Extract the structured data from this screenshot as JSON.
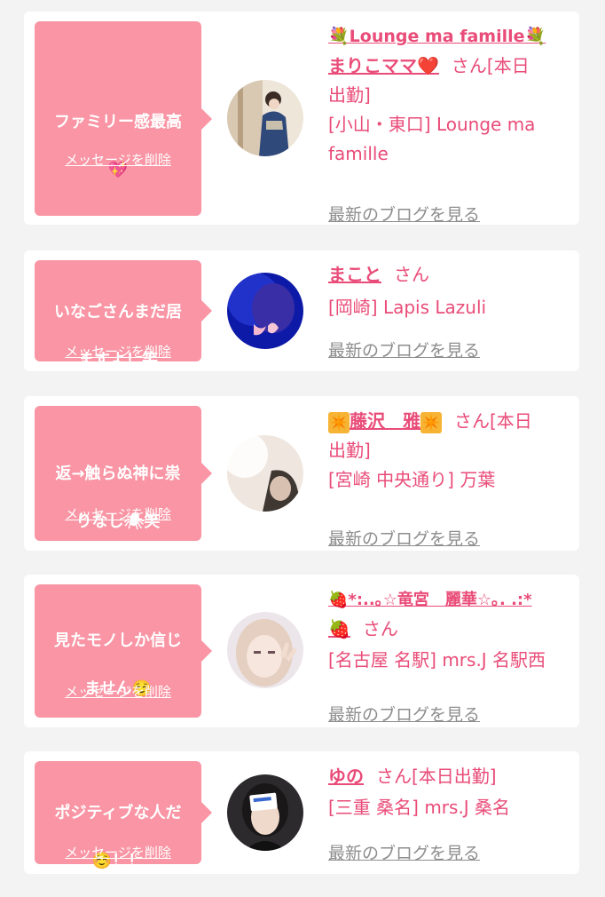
{
  "delete_label": "メッセージを削除",
  "blog_label": "最新のブログを見る",
  "san_label": "さん",
  "colors": {
    "accent": "#e94c78",
    "bubble": "#f995a4",
    "link_gray": "#8d8d8d"
  },
  "cards": [
    {
      "message_line1": "ファミリー感最高",
      "message_emoji": "💖",
      "name_prefix": "💐Lounge ma famille💐",
      "name": "まりこママ",
      "name_suffix": "❤️",
      "status": "[本日",
      "status2": "出勤]",
      "shop_line1": "[小山・東口] Lounge ma",
      "shop_line2": "famille",
      "avatar_icon": "kimono-portrait"
    },
    {
      "message_line1": "いなごさんまだ居",
      "message_line2": "ますよ！笑",
      "name": "まこと",
      "shop_line1": "[岡崎] Lapis Lazuli",
      "avatar_icon": "blue-light-butterfly-portrait"
    },
    {
      "message_line1": "返→触らぬ神に祟",
      "message_line2": "りなし🕷笑",
      "name_left": "✴️",
      "name": "藤沢　雅",
      "name_right": "✴️",
      "status": "[本日",
      "status2": "出勤]",
      "shop_line1": "[宮崎 中央通り] 万葉",
      "avatar_icon": "soft-light-portrait"
    },
    {
      "message_line1": "見たモノしか信じ",
      "message_line2": "ません☺️",
      "name_line1": "🍓*:..｡☆竜宮　麗華☆｡. .:*",
      "name_line2": "🍓",
      "shop_line1": "[名古屋 名駅] mrs.J 名駅西",
      "avatar_icon": "blonde-peace-sign-portrait"
    },
    {
      "message_line1": "ポジティブな人だ",
      "message_line2": "☺️！！",
      "name": "ゆの",
      "status": "[本日出勤]",
      "shop_line1": "[三重 桑名] mrs.J 桑名",
      "avatar_icon": "card-covered-portrait"
    }
  ]
}
